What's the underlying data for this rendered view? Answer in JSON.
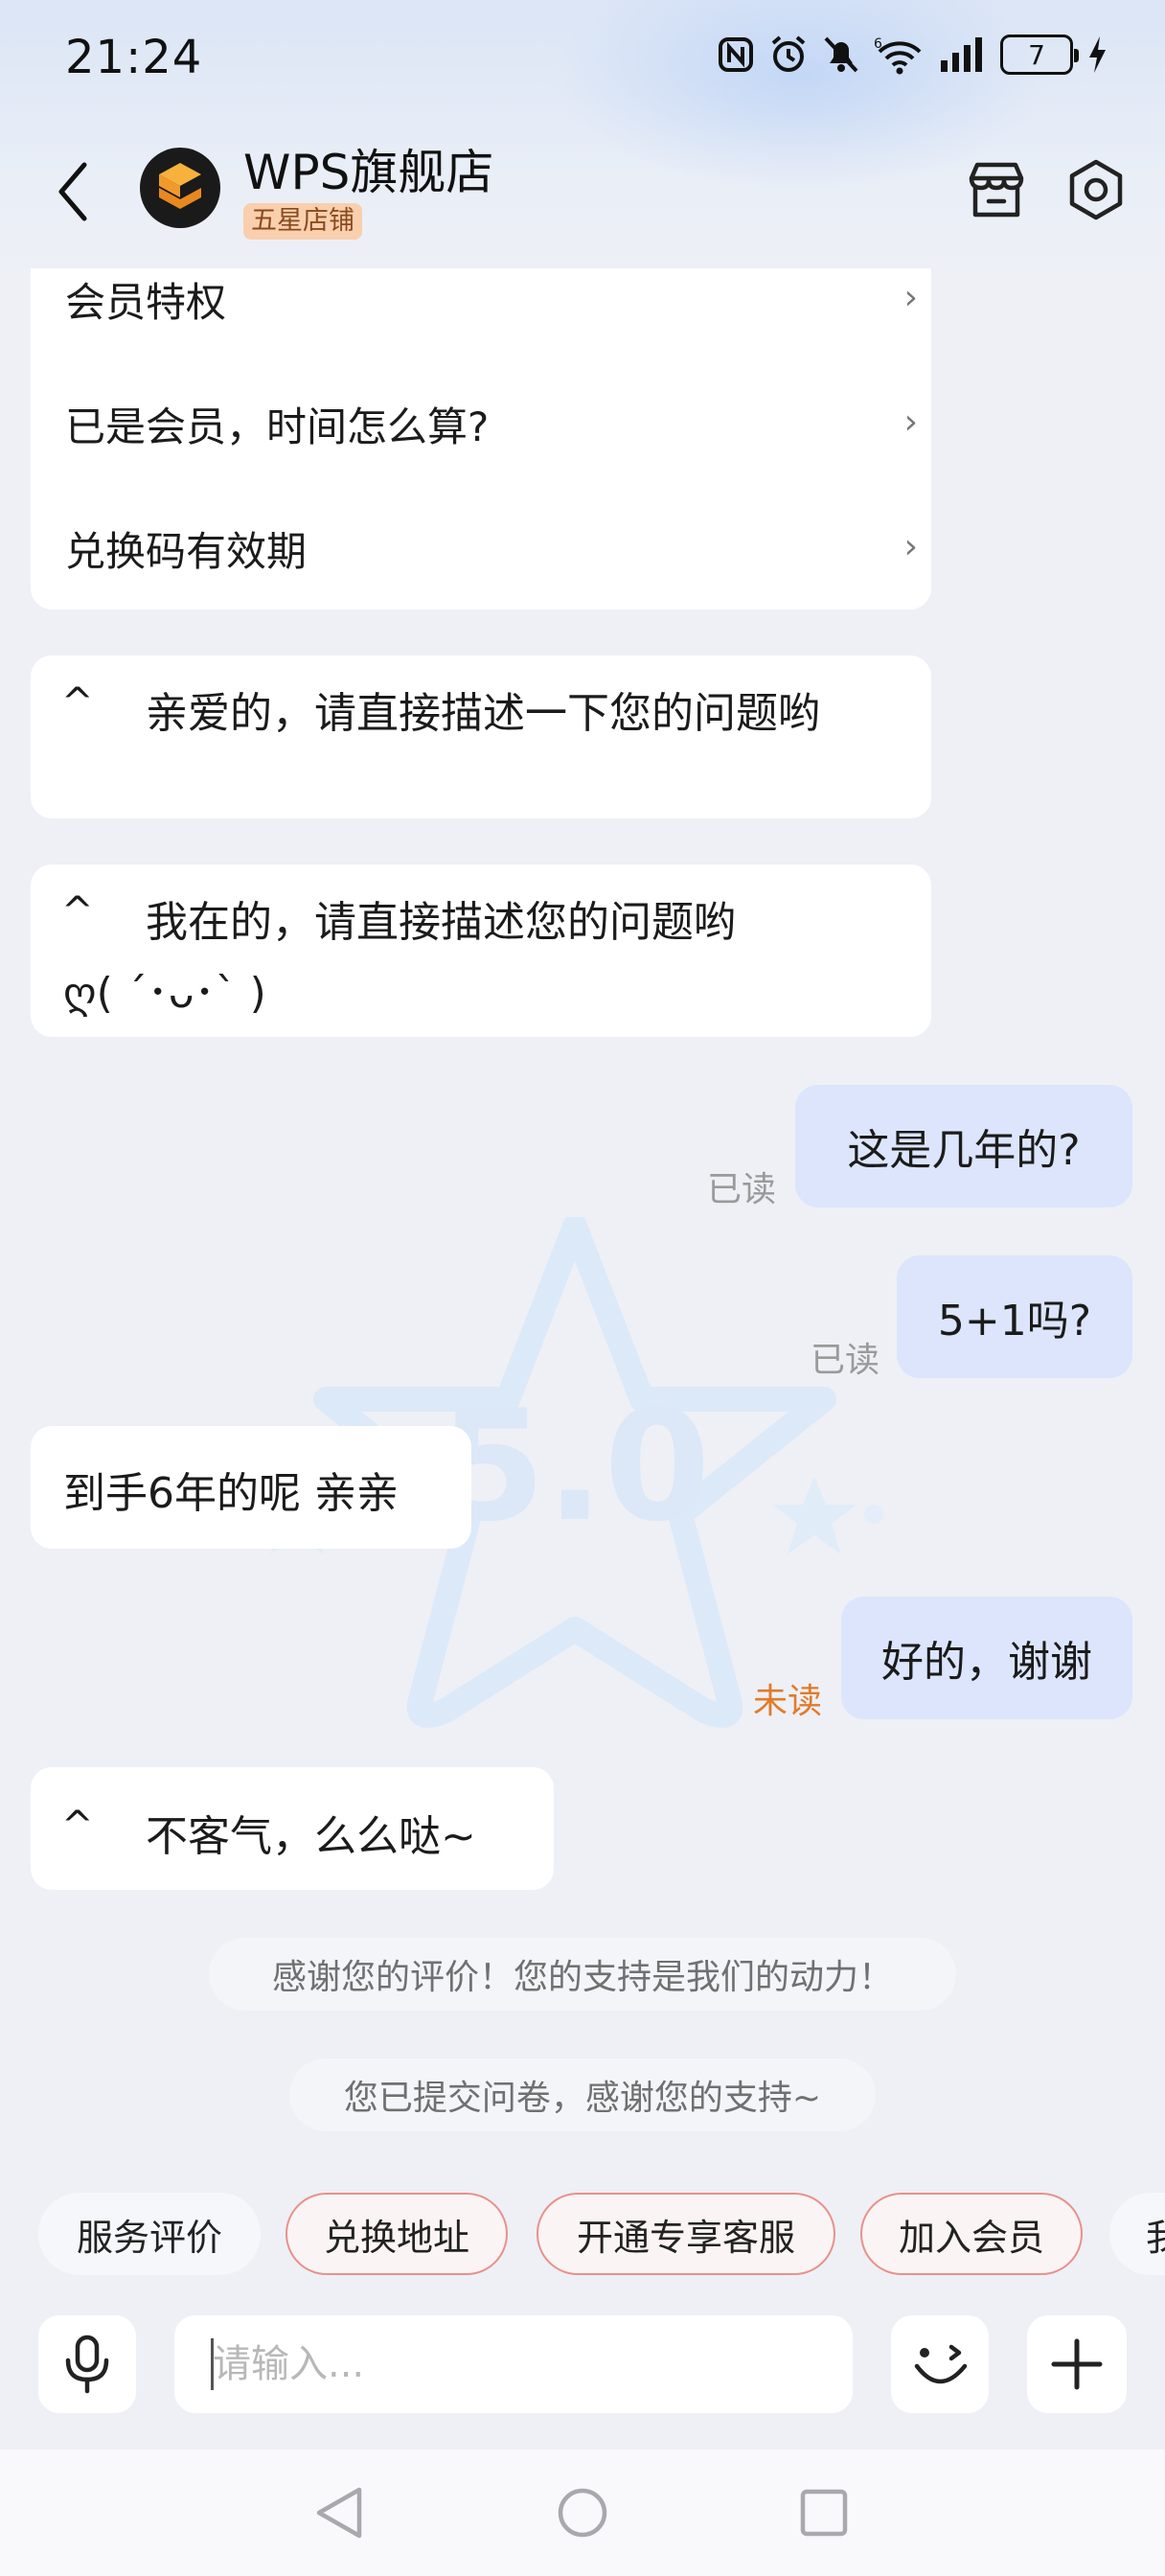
{
  "status_bar": {
    "time": "21:24",
    "battery": "7",
    "network": "6",
    "icons": [
      "nfc-icon",
      "alarm-icon",
      "mute-icon",
      "wifi-icon",
      "signal-icon",
      "battery-icon",
      "charging-icon"
    ]
  },
  "header": {
    "shop_name": "WPS旗舰店",
    "badge": "五星店铺",
    "icons": [
      "back-icon",
      "shop-logo",
      "store-icon",
      "settings-icon"
    ]
  },
  "faq": {
    "items": [
      {
        "label": "会员特权"
      },
      {
        "label": "已是会员，时间怎么算?"
      },
      {
        "label": "兑换码有效期"
      }
    ]
  },
  "messages": {
    "m1": {
      "prefix": "^",
      "text": "亲爱的，请直接描述一下您的问题哟"
    },
    "m2": {
      "prefix": "^",
      "line1": "我在的，请直接描述您的问题哟",
      "line2": "ღ(  ´･ᴗ･`  )"
    },
    "m3": {
      "text": "这是几年的?",
      "status": "已读"
    },
    "m4": {
      "text": "5+1吗?",
      "status": "已读"
    },
    "m5": {
      "text": "到手6年的呢  亲亲"
    },
    "m6": {
      "text": "好的，谢谢",
      "status": "未读"
    },
    "m7": {
      "prefix": "^",
      "text": "不客气，么么哒~"
    }
  },
  "watermark": {
    "rating": "5.0"
  },
  "system_notes": {
    "thanks": "感谢您的评价！您的支持是我们的动力！",
    "submitted": "您已提交问卷，感谢您的支持~"
  },
  "quick_replies": [
    {
      "label": "服务评价"
    },
    {
      "label": "兑换地址"
    },
    {
      "label": "开通专享客服"
    },
    {
      "label": "加入会员"
    },
    {
      "label": "我"
    }
  ],
  "input": {
    "placeholder": "请输入..."
  },
  "colors": {
    "user_bubble": "#dce5fb",
    "unread": "#e07b2a",
    "chip_outline": "#e8918a",
    "badge_bg": "#f9cfae",
    "logo_orange": "#f0a030"
  }
}
